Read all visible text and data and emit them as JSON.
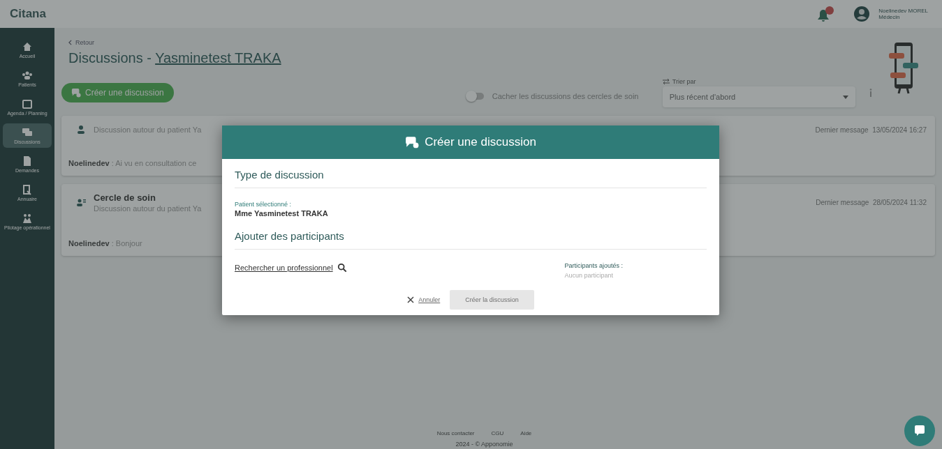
{
  "header": {
    "logo": "Citana",
    "notification": {
      "badge": true
    },
    "user": {
      "name": "Noelinedev MOREL",
      "role": "Médecin"
    }
  },
  "sidebar": {
    "items": [
      {
        "label": "Accueil",
        "selected": false
      },
      {
        "label": "Patients",
        "selected": false
      },
      {
        "label": "Agenda / Planning",
        "selected": false
      },
      {
        "label": "Discussions",
        "selected": true
      },
      {
        "label": "Demandes",
        "selected": false
      },
      {
        "label": "Annuaire",
        "selected": false
      },
      {
        "label": "Pilotage opérationnel",
        "selected": false
      }
    ]
  },
  "page": {
    "back": "Retour",
    "title": "Discussions - ",
    "patient": "Yasminetest TRAKA",
    "create_button": "Créer une discussion",
    "toggle": {
      "label": "Cacher les discussions des cercles de soin",
      "on": false
    },
    "sort": {
      "label": "Trier par",
      "value": "Plus récent d'abord"
    },
    "discussions": [
      {
        "kind": "patient",
        "subtitle": "Discussion autour du patient Ya",
        "message": "**Noelinedev** : Ai vu en consultation ce",
        "last_label": "Dernier message",
        "last_date": "13/05/2024 16:27"
      },
      {
        "kind": "circle",
        "title": "Cercle de soin",
        "subtitle": "Discussion autour du patient Ya",
        "message": "**Noelinedev** : Bonjour",
        "last_label": "Dernier message",
        "last_date": "28/05/2024 11:32"
      }
    ]
  },
  "footer": {
    "links": [
      "Nous contacter",
      "CGU",
      "Aide"
    ],
    "copyright": "2024 - © Apponomie"
  },
  "modal": {
    "title": "Créer une discussion",
    "section_type": "Type de discussion",
    "patient_label": "Patient sélectionné :",
    "patient_name": "Mme Yasminetest TRAKA",
    "section_participants": "Ajouter des participants",
    "search_link": "Rechercher un professionnel",
    "added_label": "Participants ajoutés :",
    "added_empty": "Aucun participant",
    "cancel": "Annuler",
    "submit": {
      "label": "Créer la discussion",
      "disabled": true
    }
  }
}
